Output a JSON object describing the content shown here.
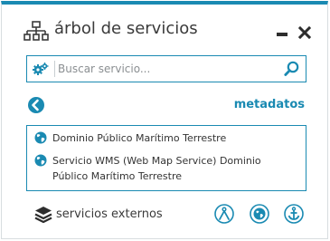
{
  "panel": {
    "title": "árbol de servicios",
    "icons": {
      "tree": "tree-hierarchy-icon",
      "minimize": "minimize-icon",
      "close": "close-icon"
    }
  },
  "search": {
    "placeholder": "Buscar servicio...",
    "value": "",
    "icons": {
      "left": "gears-icon",
      "right": "search-icon"
    }
  },
  "nav": {
    "back_icon": "back-circle-arrow-icon",
    "metadata_link": "metadatos"
  },
  "services": [
    {
      "label": "Dominio Público Marítimo Terrestre",
      "icon": "globe-icon"
    },
    {
      "label": "Servicio WMS (Web Map Service) Dominio Público Marítimo Terrestre",
      "icon": "globe-icon"
    }
  ],
  "footer": {
    "label": "servicios externos",
    "icons": [
      "layers-icon",
      "compass-icon",
      "globe-icon",
      "anchor-icon"
    ]
  },
  "colors": {
    "accent": "#1a8ab2",
    "text": "#333333",
    "border": "#d8dde0"
  }
}
